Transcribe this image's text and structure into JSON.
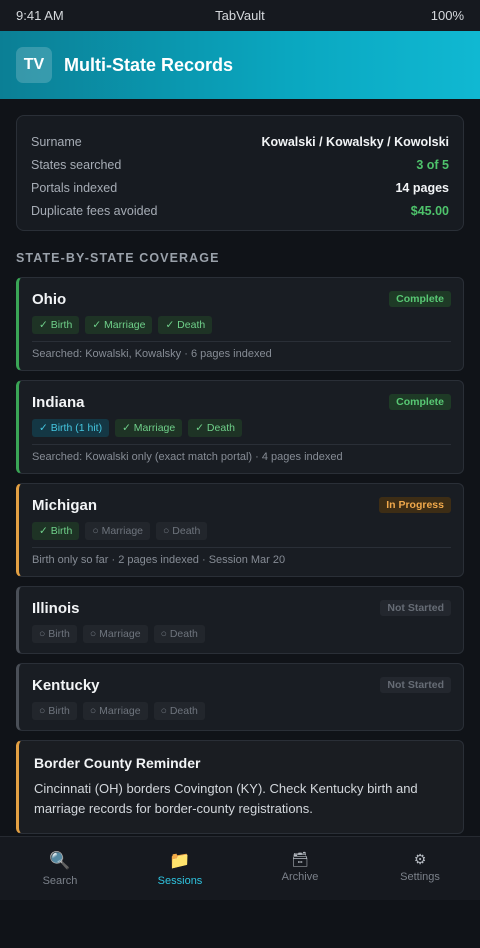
{
  "status": {
    "time": "9:41 AM",
    "app": "TabVault",
    "battery": "100%"
  },
  "header": {
    "logo": "TV",
    "title": "Multi-State Records"
  },
  "summary": [
    {
      "label": "Surname",
      "value": "Kowalski / Kowalsky / Kowolski",
      "color": "#f2f4f6"
    },
    {
      "label": "States searched",
      "value": "3 of 5",
      "color": "#4ec26b"
    },
    {
      "label": "Portals indexed",
      "value": "14 pages",
      "color": "#f2f4f6"
    },
    {
      "label": "Duplicate fees avoided",
      "value": "$45.00",
      "color": "#4ec26b"
    }
  ],
  "section_title": "STATE-BY-STATE COVERAGE",
  "states": [
    {
      "name": "Ohio",
      "status": "Complete",
      "kind": "complete",
      "chips": [
        {
          "label": "✓ Birth",
          "kind": "ok"
        },
        {
          "label": "✓ Marriage",
          "kind": "ok"
        },
        {
          "label": "✓ Death",
          "kind": "ok"
        }
      ],
      "note": "Searched: Kowalski, Kowalsky · 6 pages indexed"
    },
    {
      "name": "Indiana",
      "status": "Complete",
      "kind": "complete",
      "chips": [
        {
          "label": "✓ Birth (1 hit)",
          "kind": "hit"
        },
        {
          "label": "✓ Marriage",
          "kind": "ok"
        },
        {
          "label": "✓ Death",
          "kind": "ok"
        }
      ],
      "note": "Searched: Kowalski only (exact match portal) · 4 pages indexed"
    },
    {
      "name": "Michigan",
      "status": "In Progress",
      "kind": "progress",
      "chips": [
        {
          "label": "✓ Birth",
          "kind": "ok"
        },
        {
          "label": "○ Marriage",
          "kind": "none"
        },
        {
          "label": "○ Death",
          "kind": "none"
        }
      ],
      "note": "Birth only so far · 2 pages indexed · Session Mar 20"
    },
    {
      "name": "Illinois",
      "status": "Not Started",
      "kind": "notstarted",
      "chips": [
        {
          "label": "○ Birth",
          "kind": "none"
        },
        {
          "label": "○ Marriage",
          "kind": "none"
        },
        {
          "label": "○ Death",
          "kind": "none"
        }
      ],
      "note": ""
    },
    {
      "name": "Kentucky",
      "status": "Not Started",
      "kind": "notstarted",
      "chips": [
        {
          "label": "○ Birth",
          "kind": "none"
        },
        {
          "label": "○ Marriage",
          "kind": "none"
        },
        {
          "label": "○ Death",
          "kind": "none"
        }
      ],
      "note": ""
    }
  ],
  "reminder": {
    "title": "Border County Reminder",
    "text": "Cincinnati (OH) borders Covington (KY). Check Kentucky birth and marriage records for border-county registrations."
  },
  "tabs": [
    {
      "label": "Search",
      "icon": "search-icon",
      "glyph": "🔍",
      "active": false
    },
    {
      "label": "Sessions",
      "icon": "folder-icon",
      "glyph": "📁",
      "active": true
    },
    {
      "label": "Archive",
      "icon": "archive-box-icon",
      "glyph": "🗃",
      "active": false
    },
    {
      "label": "Settings",
      "icon": "gear-icon",
      "glyph": "⚙",
      "active": false
    }
  ]
}
